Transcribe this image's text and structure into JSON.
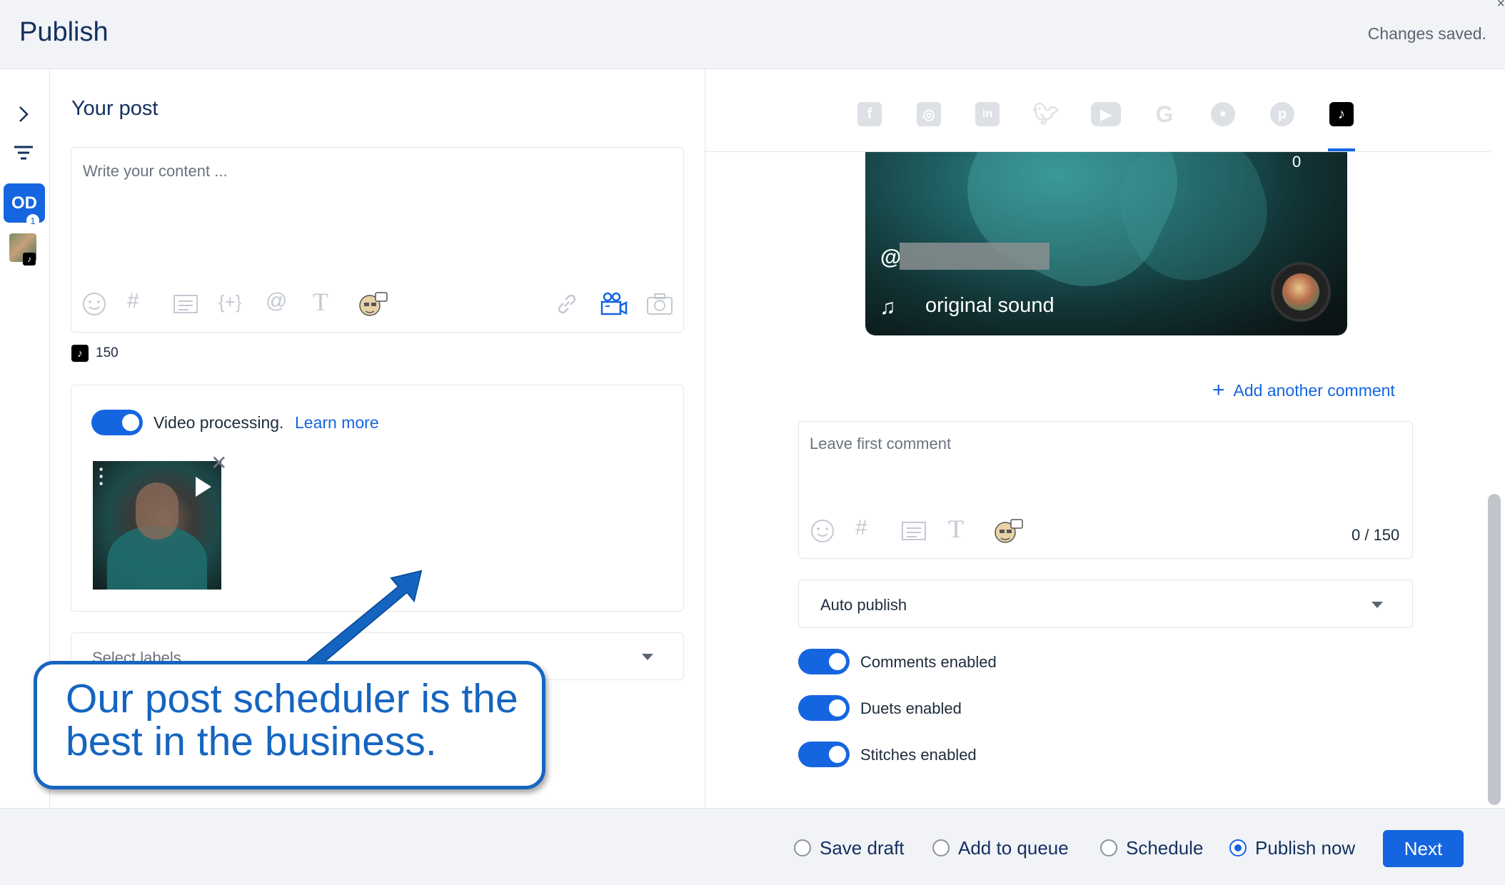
{
  "header": {
    "title": "Publish",
    "status": "Changes saved.",
    "close_glyph": "×"
  },
  "rail": {
    "account_initials": "OD",
    "account_badge": "1"
  },
  "post": {
    "section_title": "Your post",
    "content_placeholder": "Write your content ...",
    "char_limit": "150",
    "toolbar_icons": [
      "emoji-icon",
      "hashtag-icon",
      "snippet-icon",
      "variable-icon",
      "mention-icon",
      "text-format-icon",
      "ai-assistant-icon",
      "link-icon",
      "video-icon",
      "camera-icon"
    ]
  },
  "media": {
    "video_processing_label": "Video processing.",
    "learn_more": "Learn more",
    "video_processing_enabled": true
  },
  "labels": {
    "placeholder": "Select labels"
  },
  "callout": {
    "text": "Our post scheduler is the best in the business."
  },
  "networks": [
    "facebook",
    "instagram",
    "linkedin",
    "twitter",
    "youtube",
    "google",
    "reddit",
    "pinterest",
    "tiktok"
  ],
  "active_network": "tiktok",
  "preview": {
    "count": "0",
    "handle_prefix": "@",
    "sound_label": "original sound"
  },
  "comments": {
    "add_another": "Add another comment",
    "placeholder": "Leave first comment",
    "counter": "0 / 150"
  },
  "publish_mode": {
    "selected": "Auto publish"
  },
  "toggles": [
    {
      "label": "Comments enabled",
      "on": true
    },
    {
      "label": "Duets enabled",
      "on": true
    },
    {
      "label": "Stitches enabled",
      "on": true
    }
  ],
  "footer": {
    "options": [
      {
        "label": "Save draft",
        "selected": false
      },
      {
        "label": "Add to queue",
        "selected": false
      },
      {
        "label": "Schedule",
        "selected": false
      },
      {
        "label": "Publish now",
        "selected": true
      }
    ],
    "next_label": "Next"
  },
  "colors": {
    "accent": "#1565e0",
    "callout": "#1565c0",
    "header_bg": "#f1f3f7"
  }
}
